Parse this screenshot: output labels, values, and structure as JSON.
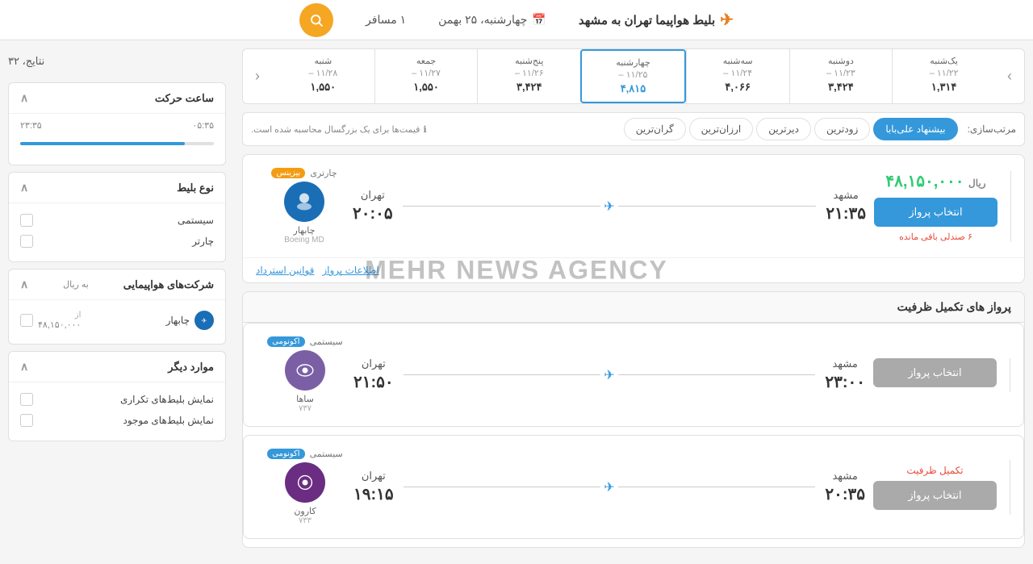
{
  "header": {
    "title": "بلیط هواپیما تهران به مشهد",
    "plane_icon": "✈",
    "date_label": "چهارشنبه، ۲۵ بهمن",
    "calendar_icon": "📅",
    "passengers": "۱ مسافر",
    "search_icon": "🔍"
  },
  "results": {
    "count_label": "نتایج، ۳۲"
  },
  "date_nav": {
    "prev_arrow": "›",
    "next_arrow": "‹",
    "items": [
      {
        "day": "یک‌شنبه",
        "date": "۱۱/۲۲ –",
        "price": "۱,۳۱۴",
        "active": false
      },
      {
        "day": "دوشنبه",
        "date": "۱۱/۲۳ –",
        "price": "۳,۴۲۴",
        "active": false
      },
      {
        "day": "سه‌شنبه",
        "date": "۱۱/۲۴ –",
        "price": "۴,۰۶۶",
        "active": false
      },
      {
        "day": "چهارشنبه",
        "date": "۱۱/۲۵ –",
        "price": "۴,۸۱۵",
        "active": true
      },
      {
        "day": "پنج‌شنبه",
        "date": "۱۱/۲۶ –",
        "price": "۳,۴۲۴",
        "active": false
      },
      {
        "day": "جمعه",
        "date": "۱۱/۲۷ –",
        "price": "۱,۵۵۰",
        "active": false
      },
      {
        "day": "شنبه",
        "date": "۱۱/۲۸ –",
        "price": "۱,۵۵۰",
        "active": false
      }
    ]
  },
  "sort": {
    "label": "مرتب‌سازی:",
    "buttons": [
      {
        "label": "بیشنهاد علی‌بابا",
        "active": true
      },
      {
        "label": "زودترین",
        "active": false
      },
      {
        "label": "دیرترین",
        "active": false
      },
      {
        "label": "ارزان‌ترین",
        "active": false
      },
      {
        "label": "گران‌ترین",
        "active": false
      }
    ],
    "price_note": "قیمت‌ها برای یک بزرگسال محاسبه شده است.",
    "info_icon": "ℹ"
  },
  "flights": [
    {
      "id": "f1",
      "price": "۴۸,۱۵۰,۰۰۰",
      "currency": "ریال",
      "select_label": "انتخاب پرواز",
      "seats_left": "۶ صندلی باقی مانده",
      "origin": "تهران",
      "origin_time": "۲۰:۰۵",
      "dest": "مشهد",
      "dest_time": "۲۱:۳۵",
      "tag1": "چارتری",
      "tag2": "بیزینس",
      "aircraft": "Boeing MD",
      "airline": "چابهار",
      "full": false,
      "action1": "اطلاعات پرواز",
      "action2": "قوانین استرداد"
    }
  ],
  "full_section": {
    "header": "پرواز های تکمیل ظرفیت",
    "flights": [
      {
        "id": "f2",
        "price": "",
        "currency": "",
        "select_label": "انتخاب پرواز",
        "full_label": "",
        "origin": "تهران",
        "origin_time": "۲۱:۵۰",
        "dest": "مشهد",
        "dest_time": "۲۳:۰۰",
        "tag1": "سیستمی",
        "tag2": "اکونومی",
        "aircraft": "۷۳۷",
        "airline": "ساها",
        "action1": "",
        "action2": ""
      },
      {
        "id": "f3",
        "price": "",
        "currency": "",
        "select_label": "انتخاب پرواز",
        "full_label": "تکمیل ظرفیت",
        "origin": "تهران",
        "origin_time": "۱۹:۱۵",
        "dest": "مشهد",
        "dest_time": "۲۰:۳۵",
        "tag1": "سیستمی",
        "tag2": "اکونومی",
        "aircraft": "۷۳۳",
        "airline": "کارون",
        "action1": "",
        "action2": ""
      }
    ]
  },
  "sidebar": {
    "results_count": "نتایج، ۳۲",
    "departure_time_filter": {
      "title": "ساعت حرکت",
      "min": "۰۵:۳۵",
      "max": "۲۳:۳۵",
      "fill_start_pct": 0,
      "fill_end_pct": 85
    },
    "ticket_type_filter": {
      "title": "نوع بلیط",
      "options": [
        {
          "label": "سیستمی",
          "checked": false
        },
        {
          "label": "چارتر",
          "checked": false
        }
      ]
    },
    "airlines_filter": {
      "title": "شرکت‌های هواپیمایی",
      "currency_label": "به ریال",
      "airlines": [
        {
          "name": "چابهار",
          "from_label": "از",
          "price": "۴۸,۱۵۰,۰۰۰",
          "checked": false
        }
      ]
    },
    "other_filter": {
      "title": "موارد دیگر",
      "options": [
        {
          "label": "نمایش بلیط‌های تکراری",
          "checked": false
        },
        {
          "label": "نمایش بلیط‌های موجود",
          "checked": false
        }
      ]
    }
  }
}
